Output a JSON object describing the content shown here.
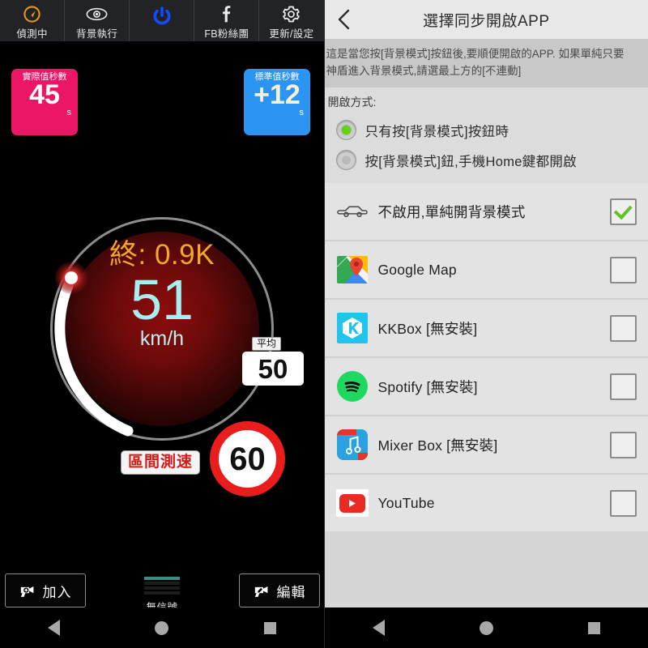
{
  "left_app": {
    "toolbar": [
      {
        "label": "偵測中",
        "icon": "radar-detect-icon"
      },
      {
        "label": "背景執行",
        "icon": "eye-icon"
      },
      {
        "label": "",
        "icon": "power-icon"
      },
      {
        "label": "FB粉絲團",
        "icon": "facebook-icon"
      },
      {
        "label": "更新/設定",
        "icon": "gear-icon"
      }
    ],
    "badges": {
      "actual": {
        "title": "實際值秒數",
        "value": "45",
        "unit": "s",
        "color": "#ec1566"
      },
      "standard": {
        "title": "標準值秒數",
        "value": "+12",
        "unit": "s",
        "color": "#2c94f2"
      }
    },
    "gauge": {
      "end_label": "終: 0.9K",
      "speed": "51",
      "unit": "km/h",
      "speed_color": "#a8eef0",
      "end_color": "#f0a92a",
      "average_label": "平均",
      "average_value": "50",
      "section_speed_label": "區間測速",
      "speed_limit": "60",
      "limit_color": "#ea1d1d"
    },
    "footer": {
      "add_button": "加入",
      "edit_button": "編輯",
      "signal_label": "無信號",
      "signal_bars_on": 1,
      "signal_bars_total": 4
    }
  },
  "right_app": {
    "header": {
      "title": "選擇同步開啟APP",
      "back_icon": "chevron-left-icon"
    },
    "description": [
      "這是當您按[背景模式]按鈕後,要順便開啟的APP. 如果單純只要",
      "神盾進入背景模式,請選最上方的[不連動]"
    ],
    "mode": {
      "label": "開啟方式:",
      "options": [
        {
          "label": "只有按[背景模式]按鈕時",
          "selected": true
        },
        {
          "label": "按[背景模式]鈕,手機Home鍵都開啟",
          "selected": false
        }
      ]
    },
    "app_list": [
      {
        "name": "不啟用,單純開背景模式",
        "icon": "car-icon",
        "checked": true
      },
      {
        "name": "Google Map",
        "icon": "google-map-icon",
        "checked": false
      },
      {
        "name": "KKBox [無安裝]",
        "icon": "kkbox-icon",
        "checked": false
      },
      {
        "name": "Spotify [無安裝]",
        "icon": "spotify-icon",
        "checked": false
      },
      {
        "name": "Mixer Box [無安裝]",
        "icon": "mixerbox-icon",
        "checked": false
      },
      {
        "name": "YouTube",
        "icon": "youtube-icon",
        "checked": false
      }
    ]
  },
  "android_nav": {
    "back": "back-triangle",
    "home": "home-circle",
    "recents": "recents-square"
  }
}
